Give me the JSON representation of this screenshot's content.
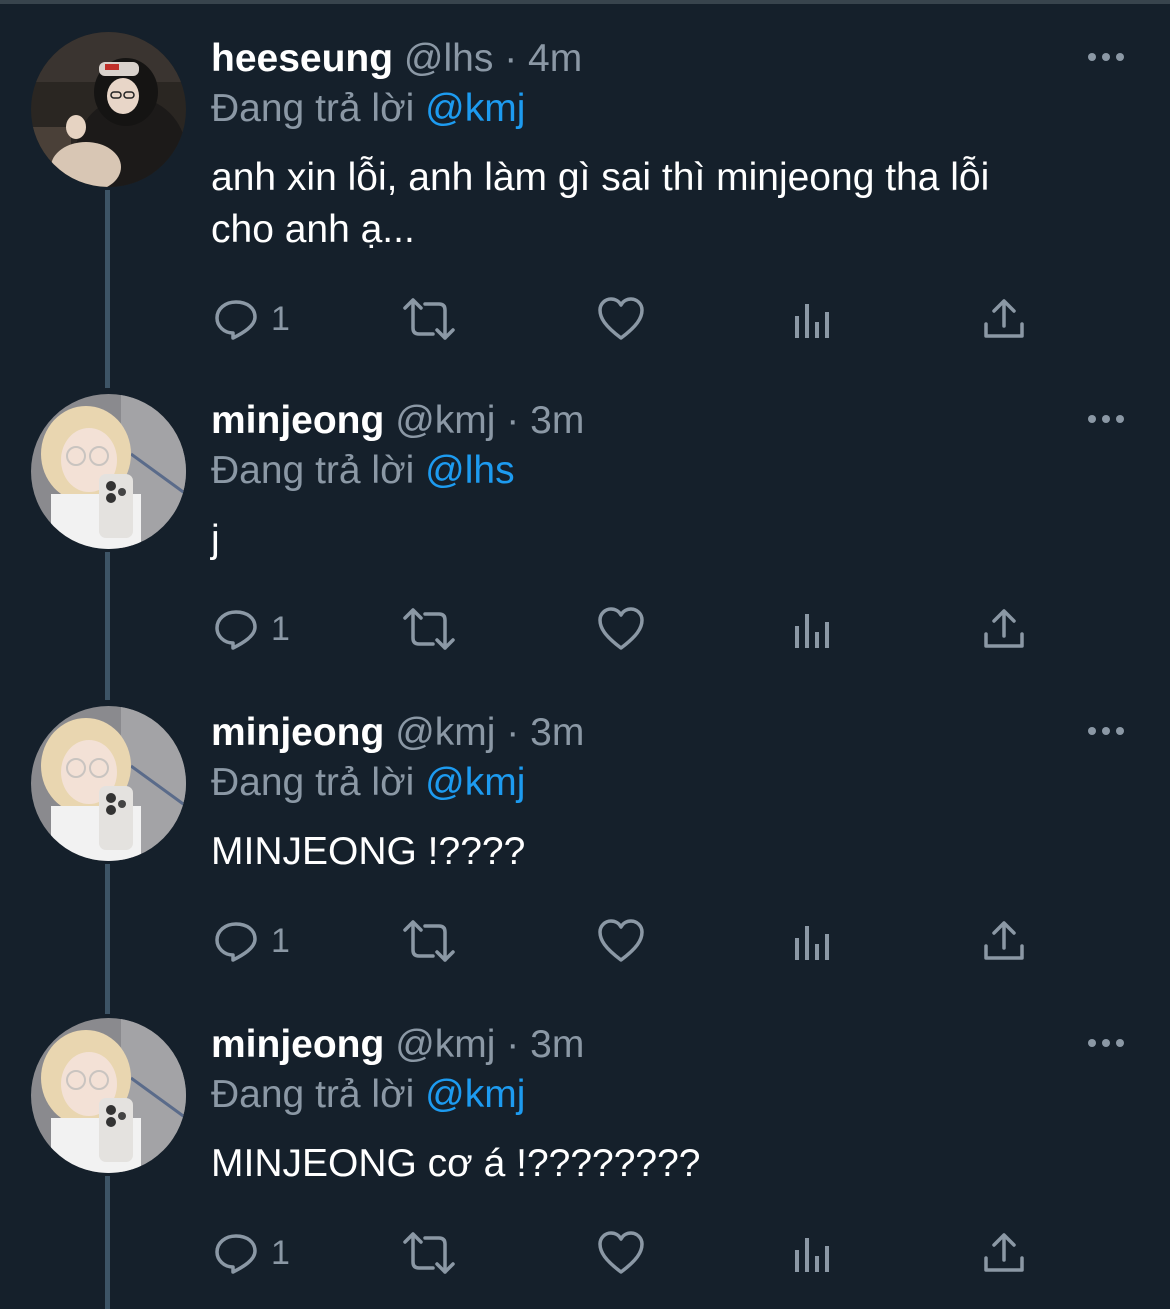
{
  "tweets": [
    {
      "name": "heeseung",
      "handle": "@lhs",
      "separator": "·",
      "time": "4m",
      "reply_prefix": "Đang trả lời",
      "reply_to": "@kmj",
      "text_line1": "anh xin lỗi, anh làm gì sai thì minjeong tha lỗi",
      "text_line2": "cho anh ạ...",
      "reply_count": "1"
    },
    {
      "name": "minjeong",
      "handle": "@kmj",
      "separator": "·",
      "time": "3m",
      "reply_prefix": "Đang trả lời",
      "reply_to": "@lhs",
      "text_line1": "j",
      "reply_count": "1"
    },
    {
      "name": "minjeong",
      "handle": "@kmj",
      "separator": "·",
      "time": "3m",
      "reply_prefix": "Đang trả lời",
      "reply_to": "@kmj",
      "text_line1": "MINJEONG !????",
      "reply_count": "1"
    },
    {
      "name": "minjeong",
      "handle": "@kmj",
      "separator": "·",
      "time": "3m",
      "reply_prefix": "Đang trả lời",
      "reply_to": "@kmj",
      "text_line1": "MINJEONG cơ á !????????",
      "reply_count": "1"
    }
  ],
  "icons": {
    "reply": "reply-icon",
    "retweet": "retweet-icon",
    "like": "heart-icon",
    "views": "views-icon",
    "share": "share-icon",
    "more": "more-icon"
  },
  "colors": {
    "background": "#15202b",
    "text": "#ffffff",
    "secondary": "#8b98a5",
    "mention": "#1d9bf0",
    "thread_line": "#3d5466"
  }
}
